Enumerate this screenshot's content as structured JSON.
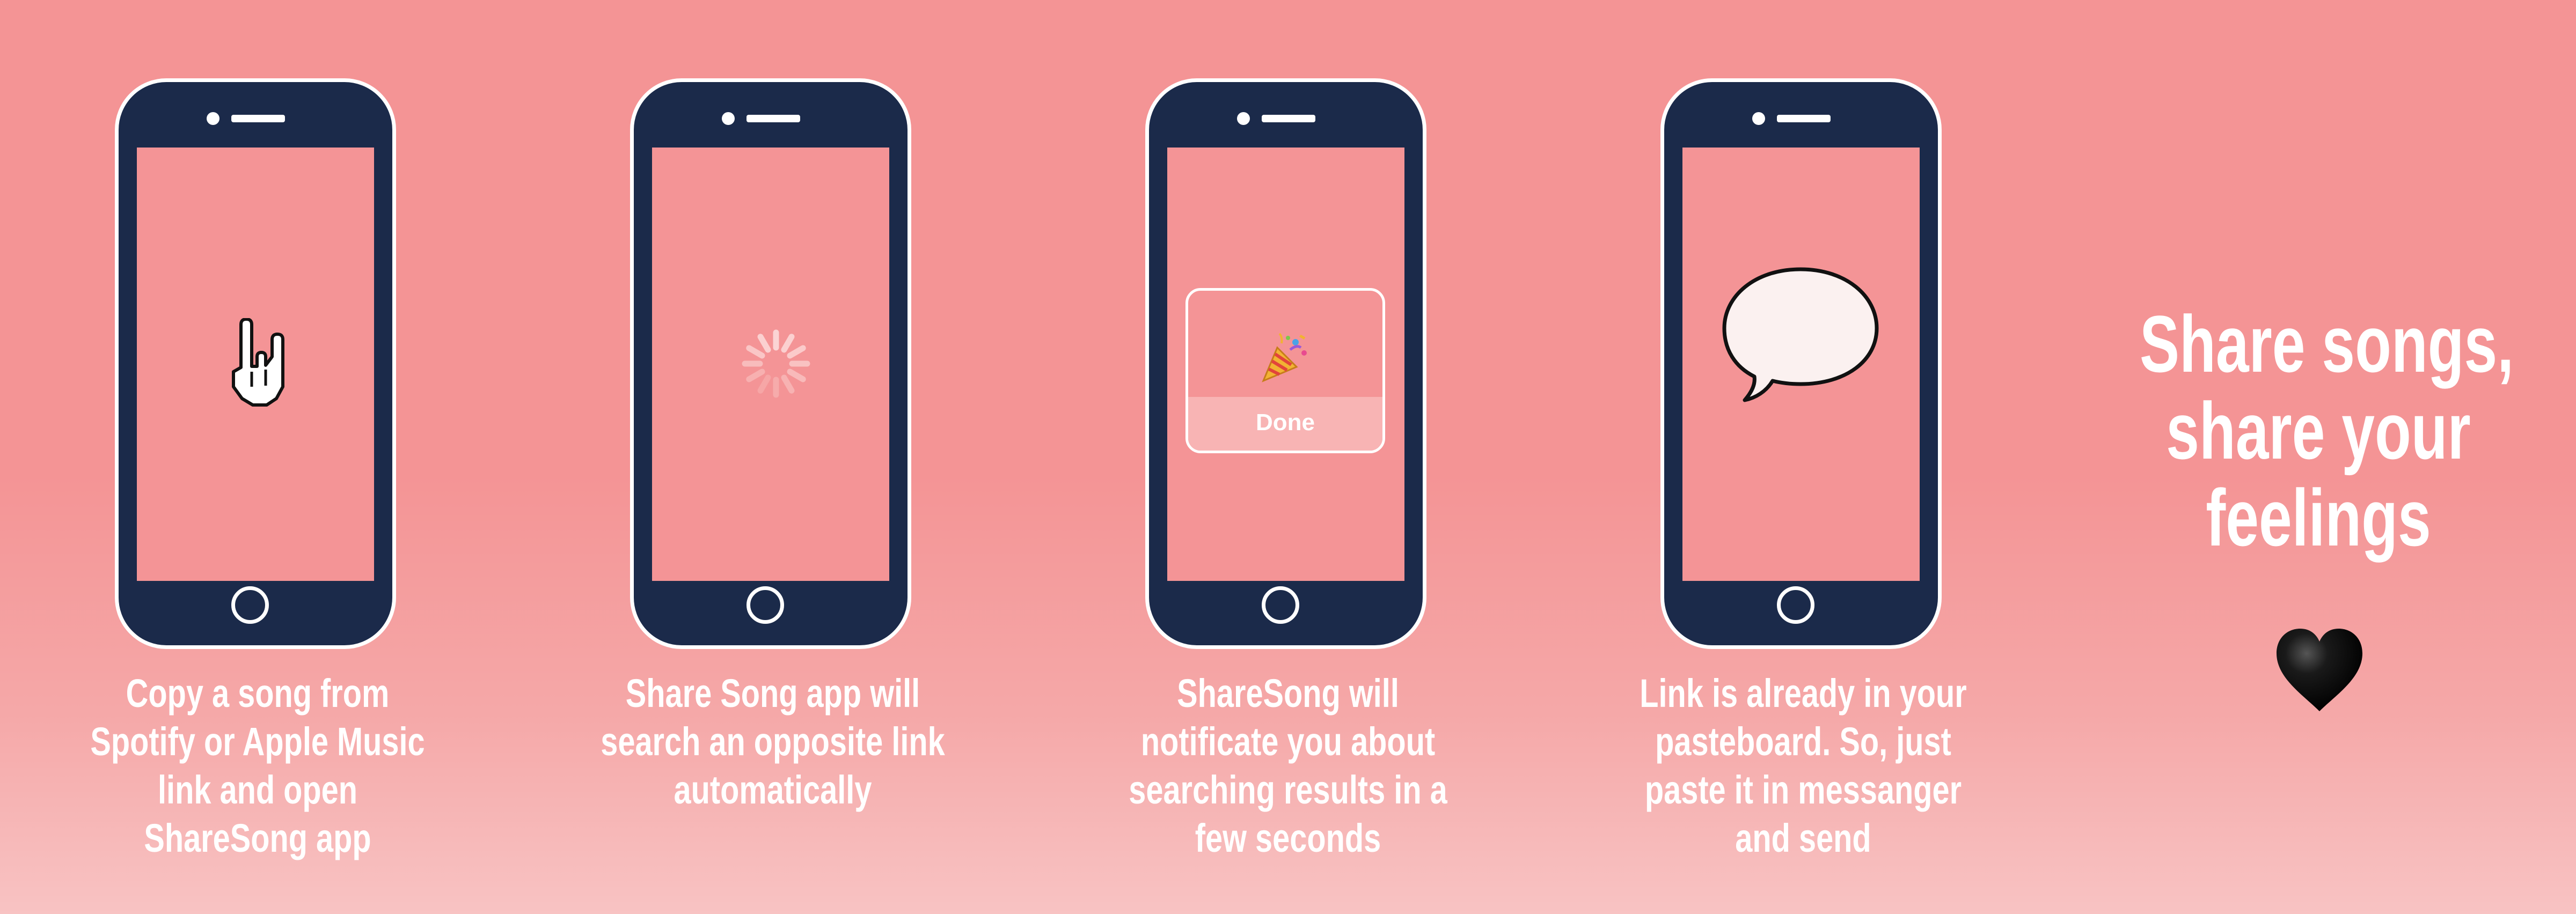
{
  "steps": [
    {
      "icon": "rock-hand-cursor-icon",
      "caption": [
        "Copy a song  from",
        "Spotify or Apple Music",
        "link and open",
        "ShareSong app"
      ]
    },
    {
      "icon": "loading-spinner-icon",
      "caption": [
        "Share Song app will",
        "search an opposite link",
        "automatically"
      ]
    },
    {
      "icon": "party-popper-icon",
      "dialog_button": "Done",
      "caption": [
        "ShareSong will",
        "notificate you about",
        "searching results in a",
        "few seconds"
      ]
    },
    {
      "icon": "speech-bubble-icon",
      "caption": [
        "Link is already in your",
        "pasteboard. So, just",
        "paste it in messanger",
        "and send"
      ]
    }
  ],
  "tagline": [
    "Share songs,",
    "share your",
    "feelings"
  ],
  "tagline_icon": "black-heart-icon",
  "colors": {
    "background": "#f49495",
    "phone_body": "#1b2a4a",
    "screen": "#f49496",
    "text": "#ffffff"
  }
}
